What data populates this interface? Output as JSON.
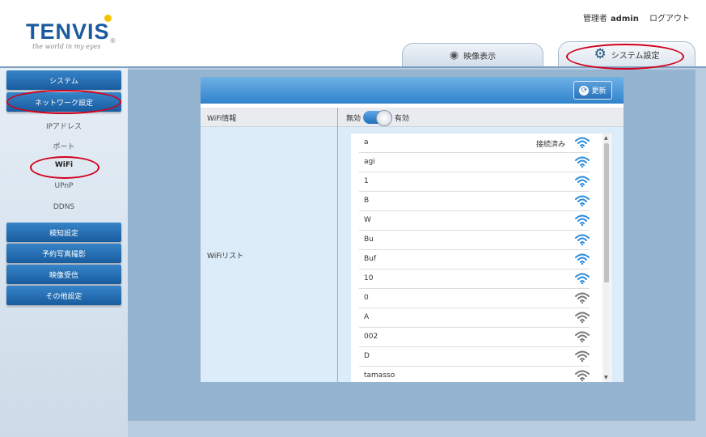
{
  "brand": {
    "name": "TENVIS",
    "reg": "®",
    "tagline": "the world in my eyes"
  },
  "header": {
    "user_prefix": "管理者",
    "user": "admin",
    "logout": "ログアウト"
  },
  "tabs": [
    {
      "label": "映像表示"
    },
    {
      "label": "システム設定"
    }
  ],
  "sidebar": {
    "system": "システム",
    "network": "ネットワーク設定",
    "sub": [
      "IPアドレス",
      "ポート",
      "WiFi",
      "UPnP",
      "DDNS"
    ],
    "detect": "検知設定",
    "schedule": "予約写真撮影",
    "video": "映像受信",
    "other": "その他設定"
  },
  "content": {
    "refresh": "更新",
    "wifi_info_label": "WiFi情報",
    "toggle_off": "無効",
    "toggle_on": "有効",
    "wifi_list_label": "WiFiリスト"
  },
  "colors": {
    "accent": "#1a5a9e",
    "highlight": "#d2001c",
    "signal_strong": "#2a8ad9",
    "signal_weak": "#777777"
  },
  "wifi_list": [
    {
      "ssid": "a",
      "status": "接続済み",
      "signal": "strong"
    },
    {
      "ssid": "agi",
      "status": "",
      "signal": "strong"
    },
    {
      "ssid": "1",
      "status": "",
      "signal": "strong"
    },
    {
      "ssid": "B",
      "status": "",
      "signal": "strong"
    },
    {
      "ssid": "W",
      "status": "",
      "signal": "strong"
    },
    {
      "ssid": "Bu",
      "status": "",
      "signal": "strong"
    },
    {
      "ssid": "Buf",
      "status": "",
      "signal": "strong"
    },
    {
      "ssid": "10",
      "status": "",
      "signal": "strong"
    },
    {
      "ssid": "0",
      "status": "",
      "signal": "weak"
    },
    {
      "ssid": "A",
      "status": "",
      "signal": "weak"
    },
    {
      "ssid": "002",
      "status": "",
      "signal": "weak"
    },
    {
      "ssid": "D",
      "status": "",
      "signal": "weak"
    },
    {
      "ssid": "tamasso",
      "status": "",
      "signal": "weak"
    }
  ]
}
